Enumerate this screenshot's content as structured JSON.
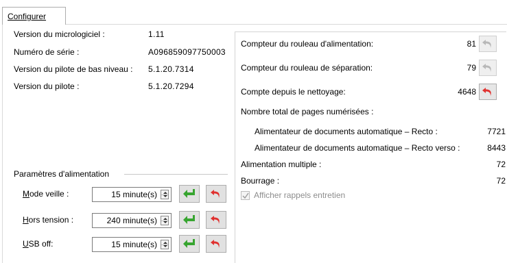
{
  "tab": {
    "label": "Configurer"
  },
  "info": [
    {
      "label": "Version du micrologiciel :",
      "value": "1.11"
    },
    {
      "label": "Numéro de série :",
      "value": "A096859097750003"
    },
    {
      "label": "Version du pilote de bas niveau :",
      "value": "5.1.20.7314"
    },
    {
      "label": "Version du pilote :",
      "value": "5.1.20.7294"
    }
  ],
  "counters": {
    "feed_roller": {
      "label": "Compteur du rouleau d'alimentation:",
      "value": "81"
    },
    "separation_roller": {
      "label": "Compteur du rouleau de séparation:",
      "value": "79"
    },
    "since_cleaning": {
      "label": "Compte depuis le nettoyage:",
      "value": "4648"
    },
    "total_pages_label": "Nombre total de pages numérisées :",
    "adf_simplex": {
      "label": "Alimentateur de documents automatique –  Recto :",
      "value": "7721"
    },
    "adf_duplex": {
      "label": "Alimentateur de documents automatique – Recto verso :",
      "value": "8443"
    },
    "multifeed": {
      "label": "Alimentation multiple :",
      "value": "72"
    },
    "jam": {
      "label": "Bourrage :",
      "value": "72"
    },
    "show_reminders": {
      "label": "Afficher rappels entretien",
      "checked": true,
      "enabled": false
    }
  },
  "power": {
    "title": "Paramètres d'alimentation",
    "rows": [
      {
        "label_u": "M",
        "label_rest": "ode veille :",
        "value": "15 minute(s)"
      },
      {
        "label_u": "H",
        "label_rest": "ors tension :",
        "value": "240 minute(s)"
      },
      {
        "label_u": "U",
        "label_rest": "SB off:",
        "value": "15 minute(s)"
      }
    ]
  },
  "icons": {
    "reset": "undo-arrow-icon",
    "apply": "enter-arrow-icon",
    "spin": "spin-arrows-icon",
    "colors": {
      "reset_active": "#e0312f",
      "reset_disabled": "#b8b8b8",
      "apply": "#37a530"
    }
  }
}
